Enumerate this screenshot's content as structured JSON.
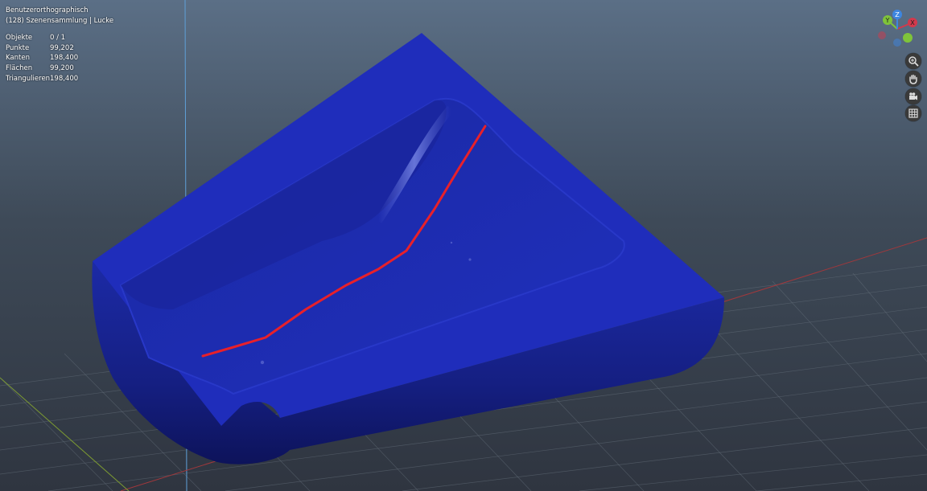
{
  "viewport": {
    "view_name": "Benutzerorthographisch",
    "collection": "(128) Szenensammlung | Lucke"
  },
  "stats": [
    {
      "label": "Objekte",
      "value": "0 / 1"
    },
    {
      "label": "Punkte",
      "value": "99,202"
    },
    {
      "label": "Kanten",
      "value": "198,400"
    },
    {
      "label": "Flächen",
      "value": "99,200"
    },
    {
      "label": "Triangulieren",
      "value": "198,400"
    }
  ],
  "gizmo": {
    "x": "X",
    "y": "Y",
    "z": "Z"
  },
  "nav_buttons": [
    "zoom-icon",
    "hand-icon",
    "camera-icon",
    "grid-icon"
  ],
  "colors": {
    "mesh": "#1e2cb8",
    "marked_line": "#e8202a",
    "x_axis": "#d2394c",
    "y_axis": "#7fc43a",
    "z_axis": "#3d86e0"
  }
}
